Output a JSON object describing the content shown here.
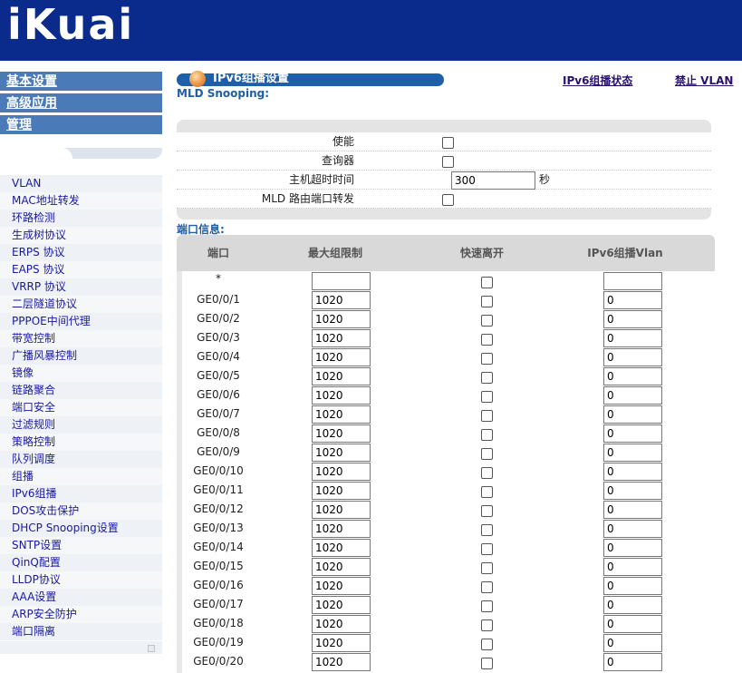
{
  "header": {
    "logo": "iKuai"
  },
  "nav": {
    "top_menus": [
      "基本设置",
      "高级应用",
      "管理"
    ],
    "items": [
      "VLAN",
      "MAC地址转发",
      "环路检测",
      "生成树协议",
      "ERPS 协议",
      "EAPS 协议",
      "VRRP 协议",
      "二层隧道协议",
      "PPPOE中间代理",
      "带宽控制",
      "广播风暴控制",
      "镜像",
      "链路聚合",
      "端口安全",
      "过滤规则",
      "策略控制",
      "队列调度",
      "组播",
      "IPv6组播",
      "DOS攻击保护",
      "DHCP Snooping设置",
      "SNTP设置",
      "QinQ配置",
      "LLDP协议",
      "AAA设置",
      "ARP安全防护",
      "端口隔离"
    ]
  },
  "page": {
    "title": "IPv6组播设置",
    "subtitle": "MLD Snooping:",
    "link_status": "IPv6组播状态",
    "link_vlan": "禁止 VLAN"
  },
  "settings": {
    "enable_label": "使能",
    "querier_label": "查询器",
    "timeout_label": "主机超时时间",
    "timeout_value": "300",
    "timeout_unit": "秒",
    "router_port_label": "MLD 路由端口转发",
    "enable_checked": false,
    "querier_checked": false,
    "router_port_checked": false
  },
  "ports": {
    "section_title": "端口信息:",
    "headers": {
      "port": "端口",
      "max_group": "最大组限制",
      "fast_leave": "快速离开",
      "vlan": "IPv6组播Vlan"
    },
    "rows": [
      {
        "name": "*",
        "max": "",
        "vlan": ""
      },
      {
        "name": "GE0/0/1",
        "max": "1020",
        "vlan": "0"
      },
      {
        "name": "GE0/0/2",
        "max": "1020",
        "vlan": "0"
      },
      {
        "name": "GE0/0/3",
        "max": "1020",
        "vlan": "0"
      },
      {
        "name": "GE0/0/4",
        "max": "1020",
        "vlan": "0"
      },
      {
        "name": "GE0/0/5",
        "max": "1020",
        "vlan": "0"
      },
      {
        "name": "GE0/0/6",
        "max": "1020",
        "vlan": "0"
      },
      {
        "name": "GE0/0/7",
        "max": "1020",
        "vlan": "0"
      },
      {
        "name": "GE0/0/8",
        "max": "1020",
        "vlan": "0"
      },
      {
        "name": "GE0/0/9",
        "max": "1020",
        "vlan": "0"
      },
      {
        "name": "GE0/0/10",
        "max": "1020",
        "vlan": "0"
      },
      {
        "name": "GE0/0/11",
        "max": "1020",
        "vlan": "0"
      },
      {
        "name": "GE0/0/12",
        "max": "1020",
        "vlan": "0"
      },
      {
        "name": "GE0/0/13",
        "max": "1020",
        "vlan": "0"
      },
      {
        "name": "GE0/0/14",
        "max": "1020",
        "vlan": "0"
      },
      {
        "name": "GE0/0/15",
        "max": "1020",
        "vlan": "0"
      },
      {
        "name": "GE0/0/16",
        "max": "1020",
        "vlan": "0"
      },
      {
        "name": "GE0/0/17",
        "max": "1020",
        "vlan": "0"
      },
      {
        "name": "GE0/0/18",
        "max": "1020",
        "vlan": "0"
      },
      {
        "name": "GE0/0/19",
        "max": "1020",
        "vlan": "0"
      },
      {
        "name": "GE0/0/20",
        "max": "1020",
        "vlan": "0"
      }
    ]
  },
  "colors": {
    "header_bg": "#0a2a8c",
    "menu_bg": "#4a7ab8",
    "accent": "#1f5ea8",
    "link": "#2a1070"
  }
}
